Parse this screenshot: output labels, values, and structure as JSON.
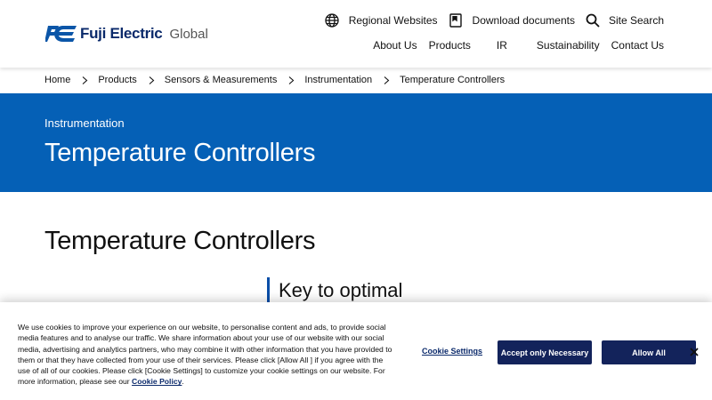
{
  "header": {
    "logo_text": "Fuji Electric",
    "logo_suffix": "Global",
    "utility": {
      "regional": "Regional Websites",
      "download": "Download documents",
      "search": "Site Search"
    },
    "nav": [
      "About Us",
      "Products",
      "IR",
      "Sustainability",
      "Contact Us"
    ]
  },
  "breadcrumb": [
    "Home",
    "Products",
    "Sensors & Measurements",
    "Instrumentation",
    "Temperature Controllers"
  ],
  "hero": {
    "subtitle": "Instrumentation",
    "title": "Temperature Controllers"
  },
  "main": {
    "title": "Temperature Controllers",
    "section_heading": "Key to optimal"
  },
  "cookie": {
    "text": "We use cookies to improve your experience on our website, to personalise content and ads, to provide social media features and to analyse our traffic. We share information about your use of our website with our social media, advertising and analytics partners, who may combine it with other information that you have provided to them or that they have collected from your use of their services. Please click [Allow All ] if you agree with the use of all of our cookies. Please click [Cookie Settings] to customize your cookie settings on our website. For more information, please see our",
    "link": "Cookie Policy",
    "link_suffix": ".",
    "settings_label": "Cookie Settings",
    "accept_necessary_label": "Accept only Necessary",
    "allow_all_label": "Allow All"
  },
  "colors": {
    "brand_blue": "#0560b6",
    "navy": "#13235b",
    "logo_navy": "#0b2a6b"
  }
}
